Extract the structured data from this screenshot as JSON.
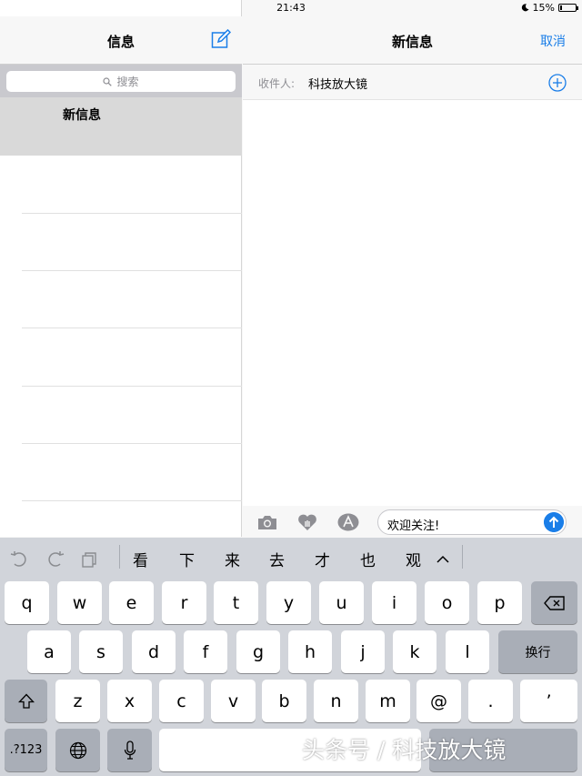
{
  "status": {
    "device": "iPad",
    "time": "21:43",
    "battery": "15%",
    "battery_level": 0.15
  },
  "left": {
    "title": "信息",
    "search_placeholder": "搜索",
    "selected_item": "新信息"
  },
  "right": {
    "title": "新信息",
    "cancel": "取消",
    "to_label": "收件人:",
    "recipient": "科技放大镜",
    "message": "欢迎关注!"
  },
  "keyboard": {
    "candidates": [
      "看",
      "下",
      "来",
      "去",
      "才",
      "也",
      "观"
    ],
    "row1": [
      "q",
      "w",
      "e",
      "r",
      "t",
      "y",
      "u",
      "i",
      "o",
      "p"
    ],
    "row2": [
      "a",
      "s",
      "d",
      "f",
      "g",
      "h",
      "j",
      "k",
      "l"
    ],
    "return_label": "换行",
    "row3": [
      "z",
      "x",
      "c",
      "v",
      "b",
      "n",
      "m",
      "@",
      ".",
      "’"
    ],
    "numbers_label": ".?123"
  },
  "watermark": "头条号 / 科技放大镜",
  "accent_color": "#1a7ee8"
}
